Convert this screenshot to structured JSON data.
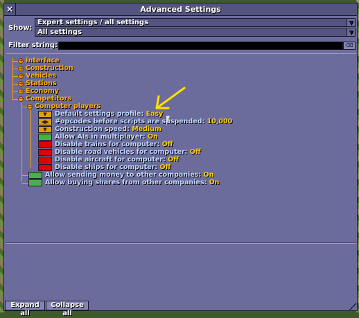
{
  "window": {
    "title": "Advanced Settings",
    "close_glyph": "×"
  },
  "show": {
    "label": "Show:",
    "category_selected": "Expert settings / all settings",
    "restrict_selected": "All settings"
  },
  "filter": {
    "label": "Filter string:",
    "value": "",
    "clear_icon": "clear-icon"
  },
  "tree": {
    "sections": [
      {
        "label": "Interface",
        "expanded": false
      },
      {
        "label": "Construction",
        "expanded": false
      },
      {
        "label": "Vehicles",
        "expanded": false
      },
      {
        "label": "Stations",
        "expanded": false
      },
      {
        "label": "Economy",
        "expanded": false
      },
      {
        "label": "Competitors",
        "expanded": true
      }
    ],
    "subsection": {
      "label": "Computer players",
      "expanded": true
    },
    "computer_settings": [
      {
        "label": "Default settings profile:",
        "value": "Easy",
        "control": "dropdown"
      },
      {
        "label": "#opcodes before scripts are suspended:",
        "value": "10,000",
        "control": "stepper"
      },
      {
        "label": "Construction speed:",
        "value": "Medium",
        "control": "dropdown"
      },
      {
        "label": "Allow AIs in multiplayer:",
        "value": "On",
        "control": "toggle-on"
      },
      {
        "label": "Disable trains for computer:",
        "value": "Off",
        "control": "toggle-off"
      },
      {
        "label": "Disable road vehicles for computer:",
        "value": "Off",
        "control": "toggle-off"
      },
      {
        "label": "Disable aircraft for computer:",
        "value": "Off",
        "control": "toggle-off"
      },
      {
        "label": "Disable ships for computer:",
        "value": "Off",
        "control": "toggle-off"
      }
    ],
    "competitor_settings": [
      {
        "label": "Allow sending money to other companies:",
        "value": "On",
        "control": "toggle-on"
      },
      {
        "label": "Allow buying shares from other companies:",
        "value": "On",
        "control": "toggle-on"
      }
    ]
  },
  "buttons": {
    "expand_all": "Expand all",
    "collapse_all": "Collapse all"
  },
  "colors": {
    "window_bg": "#6c6c9c",
    "section_text": "#ffb000",
    "setting_text": "#c0d8ff",
    "on": "#48b048",
    "off": "#e00000",
    "annotation_arrow": "#ffe000"
  }
}
